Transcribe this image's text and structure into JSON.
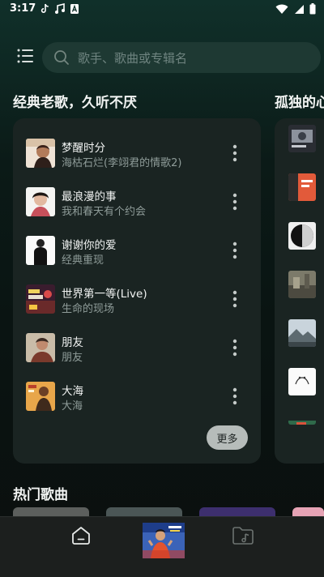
{
  "status_bar": {
    "time": "3:17"
  },
  "search": {
    "placeholder": "歌手、歌曲或专辑名"
  },
  "sections": {
    "classics_title": "经典老歌，久听不厌",
    "lonely_title": "孤独的心",
    "hot_title": "热门歌曲"
  },
  "songs": [
    {
      "title": "梦醒时分",
      "subtitle": "海枯石烂(李翊君的情歌2)"
    },
    {
      "title": "最浪漫的事",
      "subtitle": "我和春天有个约会"
    },
    {
      "title": "谢谢你的爱",
      "subtitle": "经典重现"
    },
    {
      "title": "世界第一等(Live)",
      "subtitle": "生命的现场"
    },
    {
      "title": "朋友",
      "subtitle": "朋友"
    },
    {
      "title": "大海",
      "subtitle": "大海"
    }
  ],
  "more_label": "更多",
  "colors": {
    "background": "#0b1a17",
    "card": "#1a2422",
    "search": "#1e3933",
    "nav": "#1c1f1e"
  }
}
